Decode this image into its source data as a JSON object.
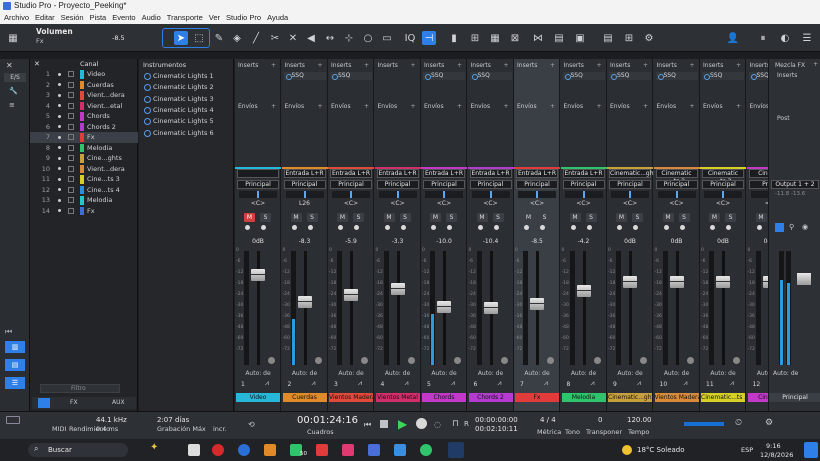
{
  "window": {
    "title": "Studio Pro - Proyecto_Peeking*"
  },
  "menu": [
    "Archivo",
    "Editar",
    "Sesión",
    "Pista",
    "Evento",
    "Audio",
    "Transporte",
    "Ver",
    "Studio Pro",
    "Ayuda"
  ],
  "toolbar": {
    "param_name": "Volumen",
    "param_track": "Fx",
    "param_value": "-8.5"
  },
  "track_list": {
    "header": "Canal",
    "tracks": [
      {
        "num": "1",
        "name": "Video",
        "color": "#27b7d8"
      },
      {
        "num": "2",
        "name": "Cuerdas",
        "color": "#e08a2a"
      },
      {
        "num": "3",
        "name": "Vient...dera",
        "color": "#e04a3a"
      },
      {
        "num": "4",
        "name": "Vient...etal",
        "color": "#d02f6a"
      },
      {
        "num": "5",
        "name": "Chords",
        "color": "#c238c8"
      },
      {
        "num": "6",
        "name": "Chords 2",
        "color": "#b43ad2"
      },
      {
        "num": "7",
        "name": "Fx",
        "color": "#e23b3b"
      },
      {
        "num": "8",
        "name": "Melodia",
        "color": "#2fc46b"
      },
      {
        "num": "9",
        "name": "Cine...ghts",
        "color": "#c8a03a"
      },
      {
        "num": "10",
        "name": "Vient...dera",
        "color": "#d88a3a"
      },
      {
        "num": "11",
        "name": "Cine...ts 3",
        "color": "#d6d026"
      },
      {
        "num": "12",
        "name": "Cine...ts 4",
        "color": "#2b8de0"
      },
      {
        "num": "13",
        "name": "Melodia",
        "color": "#23c8c8"
      },
      {
        "num": "14",
        "name": "Fx",
        "color": "#3a6fd8"
      }
    ],
    "filter_placeholder": "Filtro",
    "bottom_tabs": [
      "FX",
      "AUX"
    ]
  },
  "instruments": {
    "header": "Instrumentos",
    "items": [
      "Cinematic Lights 1",
      "Cinematic Lights 2",
      "Cinematic Lights 3",
      "Cinematic Lights 4",
      "Cinematic Lights 5",
      "Cinematic Lights 6"
    ]
  },
  "mixer": {
    "inserts_label": "Inserts",
    "sends_label": "Envíos",
    "insert_plugin": "SSQ",
    "auto_label": "Auto: de",
    "channels": [
      {
        "num": "1",
        "name": "Video",
        "color": "#27b7d8",
        "input": "",
        "output": "Principal",
        "pan": "<C>",
        "vol": "0dB",
        "mute": true,
        "ins": false,
        "fader": 0.82,
        "meter": 0
      },
      {
        "num": "2",
        "name": "Cuerdas",
        "color": "#e08a2a",
        "input": "Entrada L+R",
        "output": "Principal",
        "pan": "L26",
        "vol": "-8.3",
        "mute": false,
        "ins": true,
        "fader": 0.55,
        "meter": 0.4
      },
      {
        "num": "3",
        "name": "Vientos Madera",
        "color": "#e04a3a",
        "input": "Entrada L+R",
        "output": "Principal",
        "pan": "<C>",
        "vol": "-5.9",
        "mute": false,
        "ins": true,
        "fader": 0.62,
        "meter": 0
      },
      {
        "num": "4",
        "name": "Vientos Metal",
        "color": "#d02f6a",
        "input": "Entrada L+R",
        "output": "Principal",
        "pan": "<C>",
        "vol": "-3.3",
        "mute": false,
        "ins": false,
        "fader": 0.68,
        "meter": 0
      },
      {
        "num": "5",
        "name": "Chords",
        "color": "#c238c8",
        "input": "Entrada L+R",
        "output": "Principal",
        "pan": "<C>",
        "vol": "-10.0",
        "mute": false,
        "ins": true,
        "fader": 0.5,
        "meter": 0.45
      },
      {
        "num": "6",
        "name": "Chords 2",
        "color": "#b43ad2",
        "input": "Entrada L+R",
        "output": "Principal",
        "pan": "<C>",
        "vol": "-10.4",
        "mute": false,
        "ins": true,
        "fader": 0.49,
        "meter": 0
      },
      {
        "num": "7",
        "name": "Fx",
        "color": "#e23b3b",
        "input": "Entrada L+R",
        "output": "Principal",
        "pan": "<C>",
        "vol": "-8.5",
        "mute": false,
        "ins": false,
        "fader": 0.53,
        "meter": 0
      },
      {
        "num": "8",
        "name": "Melodia",
        "color": "#2fc46b",
        "input": "Entrada L+R",
        "output": "Principal",
        "pan": "<C>",
        "vol": "-4.2",
        "mute": false,
        "ins": true,
        "fader": 0.66,
        "meter": 0
      },
      {
        "num": "9",
        "name": "Cinematic...ghts",
        "color": "#c8a03a",
        "input": "Cinematic...ghts",
        "output": "Principal",
        "pan": "<C>",
        "vol": "0dB",
        "mute": false,
        "ins": true,
        "fader": 0.75,
        "meter": 0
      },
      {
        "num": "10",
        "name": "Vientos Madera",
        "color": "#d88a3a",
        "input": "Cinematic ...ts 2",
        "output": "Principal",
        "pan": "<C>",
        "vol": "0dB",
        "mute": false,
        "ins": true,
        "fader": 0.75,
        "meter": 0
      },
      {
        "num": "11",
        "name": "Cinematic...ts 3",
        "color": "#d6d026",
        "input": "Cinematic ...ts 3",
        "output": "Principal",
        "pan": "<C>",
        "vol": "0dB",
        "mute": false,
        "ins": true,
        "fader": 0.75,
        "meter": 0
      },
      {
        "num": "12",
        "name": "Cinema",
        "color": "#c238c8",
        "input": "Cinema",
        "output": "Princ",
        "pan": "<C",
        "vol": "0dB",
        "mute": false,
        "ins": true,
        "fader": 0.75,
        "meter": 0
      }
    ],
    "main": {
      "header": "Mezcla FX",
      "inserts": "Inserts",
      "post": "Post",
      "output": "Output 1 + 2",
      "levels": "-11.8   -13.6",
      "name": "Principal",
      "auto": "Auto: de"
    }
  },
  "transport": {
    "samplerate": "44.1 kHz",
    "latency": "0.4 ms",
    "rate_label": "Rendimiento",
    "midi_label": "MIDI",
    "days": "2:07 días",
    "rec_max": "Grabación Máx",
    "time": "00:01:24:16",
    "time_label": "Cuadros",
    "loop_start": "00:00:00:00",
    "loop_end": "00:02:10:11",
    "metric": "4 / 4",
    "metric_label": "Métrica",
    "key_label": "Tono",
    "transpose": "0",
    "transpose_label": "Transponer",
    "tempo": "120.00",
    "tempo_label": "Tempo",
    "inc": "incr."
  },
  "taskbar": {
    "search": "Buscar",
    "weather": "18°C  Soleado",
    "lang": "ESP",
    "time": "9:16",
    "date": "12/8/2026",
    "badge": "50"
  }
}
